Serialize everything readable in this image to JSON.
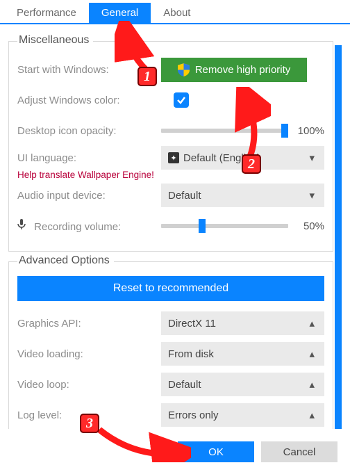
{
  "tabs": {
    "performance": "Performance",
    "general": "General",
    "about": "About"
  },
  "misc": {
    "title": "Miscellaneous",
    "start_with_windows": "Start with Windows:",
    "remove_priority": "Remove high priority",
    "adjust_color": "Adjust Windows color:",
    "desktop_opacity": "Desktop icon opacity:",
    "opacity_value": "100%",
    "ui_language": "UI language:",
    "translate_link": "Help translate Wallpaper Engine!",
    "lang_value": "Default (English)",
    "audio_device": "Audio input device:",
    "audio_value": "Default",
    "recording_volume": "Recording volume:",
    "volume_value": "50%"
  },
  "advanced": {
    "title": "Advanced Options",
    "reset": "Reset to recommended",
    "graphics_api": "Graphics API:",
    "graphics_value": "DirectX 11",
    "video_loading": "Video loading:",
    "video_loading_value": "From disk",
    "video_loop": "Video loop:",
    "video_loop_value": "Default",
    "log_level": "Log level:",
    "log_level_value": "Errors only"
  },
  "footer": {
    "ok": "OK",
    "cancel": "Cancel"
  },
  "annotations": {
    "n1": "1",
    "n2": "2",
    "n3": "3"
  },
  "icons": {
    "globe": "❐"
  }
}
